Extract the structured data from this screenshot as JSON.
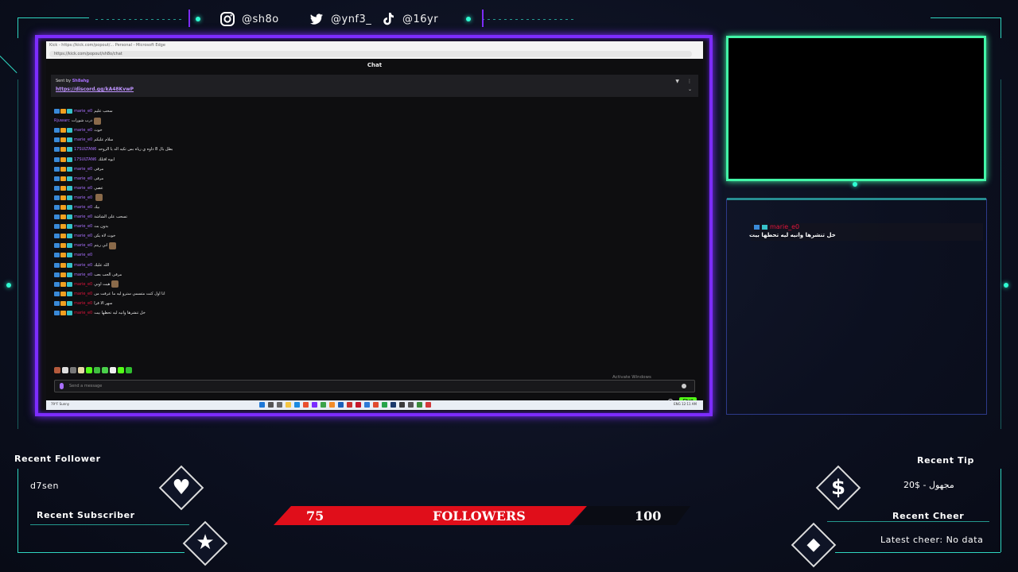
{
  "socials": [
    {
      "icon": "instagram-icon",
      "handle": "@sh8o"
    },
    {
      "icon": "twitter-icon",
      "handle": "@ynf3_"
    },
    {
      "icon": "tiktok-icon",
      "handle": "@16yr"
    }
  ],
  "browser": {
    "tab_text": "Kick - https://kick.com/popout/... Personal - Microsoft Edge",
    "url": "https://kick.com/popout/sh8o/chat"
  },
  "chat": {
    "title": "Chat",
    "pinned": {
      "sent_by_prefix": "Sent by",
      "sent_by_user": "Sh8ahg",
      "link": "https://discord.gg/kA48KvwP"
    },
    "messages": [
      {
        "user": "marie_e0",
        "color": "#a970ff",
        "text": "سحب عليم",
        "badges": true,
        "emote": false
      },
      {
        "user": "Rjuwarc",
        "color": "#a970ff",
        "text": "درب شورات",
        "badges": false,
        "emote": true
      },
      {
        "user": "marie_e0",
        "color": "#a970ff",
        "text": "خوث",
        "badges": true,
        "emote": false
      },
      {
        "user": "marie_e0",
        "color": "#a970ff",
        "text": "سلام عليكم",
        "badges": true,
        "emote": false
      },
      {
        "user": "17SULTAN6",
        "color": "#a970ff",
        "text": "بطل بال 8 داوه ي رياه بس تكيه اله يا الروحه",
        "badges": true,
        "emote": false
      },
      {
        "user": "17SULTAN6",
        "color": "#a970ff",
        "text": "ايوه اقتلك",
        "badges": true,
        "emote": false
      },
      {
        "user": "marie_e0",
        "color": "#a970ff",
        "text": "مرقى",
        "badges": true,
        "emote": false
      },
      {
        "user": "marie_e0",
        "color": "#a970ff",
        "text": "مرقى",
        "badges": true,
        "emote": false
      },
      {
        "user": "marie_e0",
        "color": "#a970ff",
        "text": "عصي",
        "badges": true,
        "emote": false
      },
      {
        "user": "marie_e0",
        "color": "#a970ff",
        "text": "",
        "badges": true,
        "emote": true
      },
      {
        "user": "marie_e0",
        "color": "#a970ff",
        "text": "بيك",
        "badges": true,
        "emote": false
      },
      {
        "user": "marie_e0",
        "color": "#a970ff",
        "text": "تسحب على الشاشة",
        "badges": true,
        "emote": false
      },
      {
        "user": "marie_e0",
        "color": "#a970ff",
        "text": "بدون بث",
        "badges": true,
        "emote": false
      },
      {
        "user": "marie_e0",
        "color": "#a970ff",
        "text": "خوث لاة يكن",
        "badges": true,
        "emote": false
      },
      {
        "user": "marie_e0",
        "color": "#a970ff",
        "text": "اني ريتم",
        "badges": true,
        "emote": true
      },
      {
        "user": "marie_e0",
        "color": "#a970ff",
        "text": "",
        "badges": true,
        "emote": false
      },
      {
        "user": "marie_e0",
        "color": "#a970ff",
        "text": "الله عليك",
        "badges": true,
        "emote": false
      },
      {
        "user": "marie_e0",
        "color": "#a970ff",
        "text": "مرقى الحب بعب",
        "badges": true,
        "emote": false
      },
      {
        "user": "marie_e0",
        "color": "#e0143c",
        "text": "هيت اوني",
        "badges": true,
        "emote": true
      },
      {
        "user": "marie_e0",
        "color": "#e0143c",
        "text": "انا اول كنت متسمي سترو ليه ما عرفت من",
        "badges": true,
        "emote": false
      },
      {
        "user": "marie_e0",
        "color": "#e0143c",
        "text": "سهر الا قرا",
        "badges": true,
        "emote": false
      },
      {
        "user": "marie_e0",
        "color": "#e0143c",
        "text": "خل تنشرها وانيه ليه تحطها بيت",
        "badges": true,
        "emote": false
      }
    ],
    "input_placeholder": "Send a message",
    "send_label": "Chat",
    "activate_title": "Activate Windows",
    "activate_sub": "Go to Settings to activate Windows."
  },
  "taskbar": {
    "weather": "79°F Sunny",
    "tray": "ENG 12:11 AM"
  },
  "alert": {
    "user": "marie_e0",
    "text": "خل تنشرها وانيه ليه تحطها بيت"
  },
  "widgets": {
    "recent_follower_label": "Recent Follower",
    "recent_follower_value": "d7sen",
    "recent_subscriber_label": "Recent Subscriber",
    "recent_tip_label": "Recent Tip",
    "recent_tip_value": "20$ - مجهول",
    "recent_cheer_label": "Recent Cheer",
    "recent_cheer_value": "Latest cheer: No data"
  },
  "goal": {
    "current": "75",
    "label": "FOLLOWERS",
    "target": "100"
  },
  "colors": {
    "accent_teal": "#2fd6c0",
    "frame_purple": "#7d2cff",
    "cam_green": "#42f5a7",
    "goal_red": "#e00e1a",
    "kick_green": "#53fc18"
  }
}
